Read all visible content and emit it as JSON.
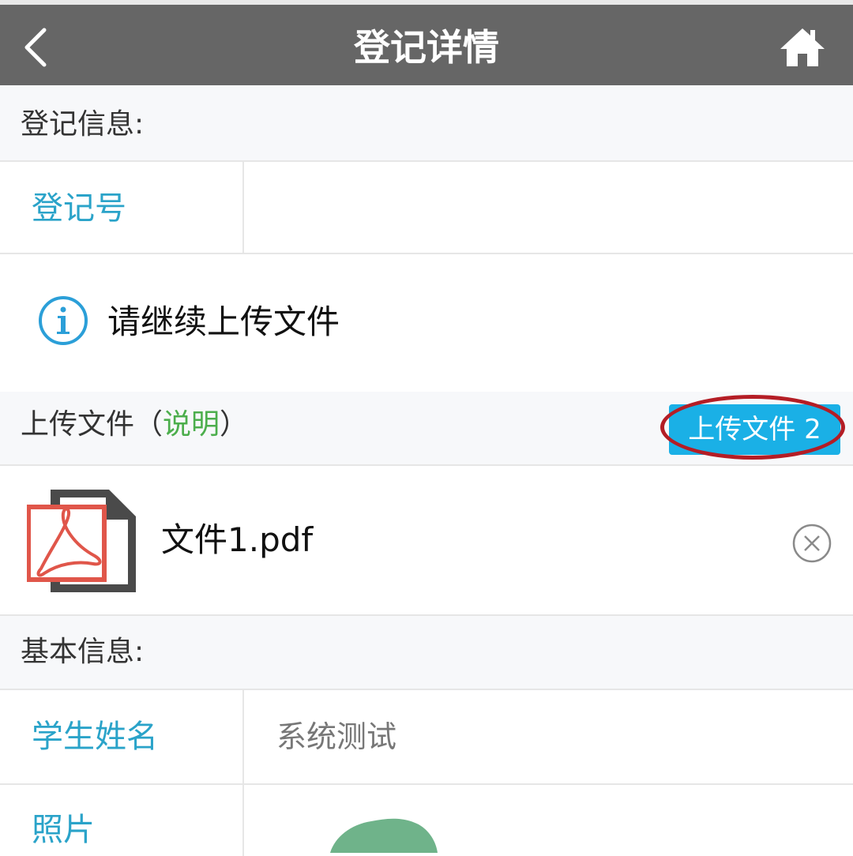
{
  "header": {
    "title": "登记详情",
    "back_icon": "chevron-left-icon",
    "home_icon": "home-icon",
    "bg_color": "#666666"
  },
  "registration_section": {
    "label": "登记信息:",
    "fields": [
      {
        "key": "登记号",
        "value": ""
      }
    ]
  },
  "notice": {
    "icon": "info-icon",
    "text": "请继续上传文件",
    "icon_color": "#2b9fd8"
  },
  "upload_section": {
    "label": "上传文件",
    "paren_open": "（",
    "explain_link": "说明",
    "paren_close": "）",
    "upload_button_label": "上传文件 2",
    "button_color": "#1ab0e6",
    "highlight_color": "#b41d25"
  },
  "files": [
    {
      "icon": "pdf-file-icon",
      "name": "文件1.pdf",
      "remove_icon": "close-circle-icon"
    }
  ],
  "basic_section": {
    "label": "基本信息:",
    "fields": [
      {
        "key": "学生姓名",
        "value": "系统测试"
      },
      {
        "key": "照片",
        "value": ""
      }
    ]
  },
  "colors": {
    "key_text": "#2aa3c9",
    "explain_link": "#4cae4c"
  }
}
